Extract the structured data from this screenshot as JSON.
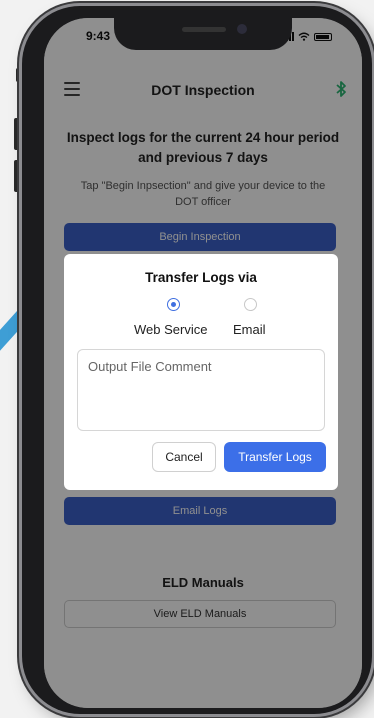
{
  "status_bar": {
    "time": "9:43"
  },
  "navbar": {
    "title": "DOT Inspection",
    "menu_icon": "hamburger-menu-icon",
    "bluetooth_icon": "bluetooth-icon",
    "bluetooth_color": "#2bb673"
  },
  "main": {
    "headline": "Inspect logs for the current 24 hour period and previous 7 days",
    "instruction": "Tap \"Begin Inpsection\" and give your device to the DOT officer",
    "begin_button": "Begin Inspection",
    "email_button": "Email Logs",
    "manuals_title": "ELD Manuals",
    "manuals_button": "View ELD Manuals"
  },
  "modal": {
    "title": "Transfer Logs via",
    "options": [
      {
        "label": "Web Service",
        "selected": true
      },
      {
        "label": "Email",
        "selected": false
      }
    ],
    "comment_placeholder": "Output File Comment",
    "cancel_label": "Cancel",
    "transfer_label": "Transfer Logs"
  },
  "colors": {
    "primary": "#3b60c9",
    "transfer_button": "#3c6fe8",
    "radio_selected": "#3f6fe0"
  }
}
